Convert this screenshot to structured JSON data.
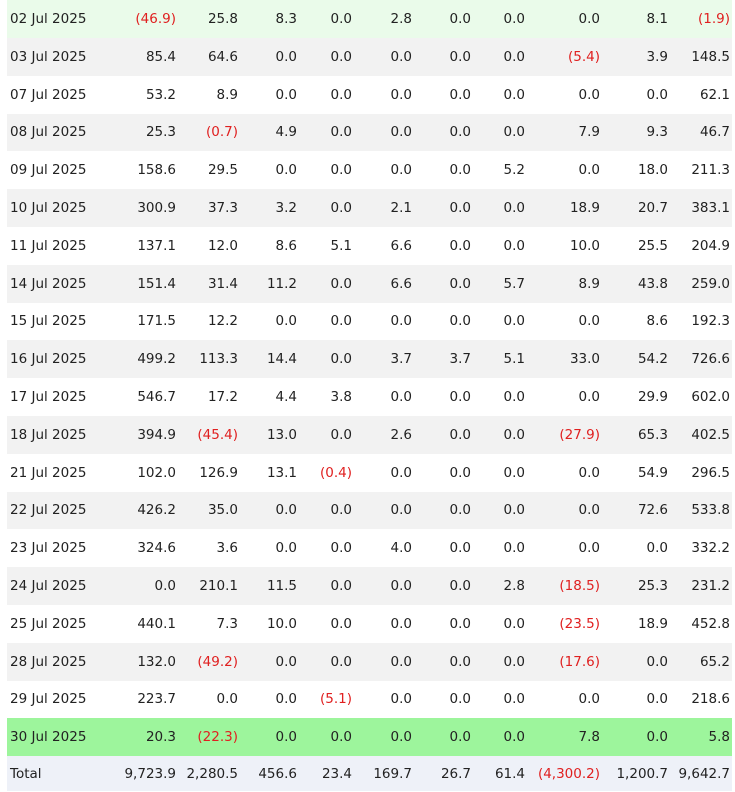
{
  "rows": [
    {
      "date": "02 Jul 2025",
      "style": "first",
      "values": [
        "(46.9)",
        "25.8",
        "8.3",
        "0.0",
        "2.8",
        "0.0",
        "0.0",
        "0.0",
        "8.1",
        "(1.9)"
      ]
    },
    {
      "date": "03 Jul 2025",
      "style": "striped",
      "values": [
        "85.4",
        "64.6",
        "0.0",
        "0.0",
        "0.0",
        "0.0",
        "0.0",
        "(5.4)",
        "3.9",
        "148.5"
      ]
    },
    {
      "date": "07 Jul 2025",
      "style": "plain",
      "values": [
        "53.2",
        "8.9",
        "0.0",
        "0.0",
        "0.0",
        "0.0",
        "0.0",
        "0.0",
        "0.0",
        "62.1"
      ]
    },
    {
      "date": "08 Jul 2025",
      "style": "striped",
      "values": [
        "25.3",
        "(0.7)",
        "4.9",
        "0.0",
        "0.0",
        "0.0",
        "0.0",
        "7.9",
        "9.3",
        "46.7"
      ]
    },
    {
      "date": "09 Jul 2025",
      "style": "plain",
      "values": [
        "158.6",
        "29.5",
        "0.0",
        "0.0",
        "0.0",
        "0.0",
        "5.2",
        "0.0",
        "18.0",
        "211.3"
      ]
    },
    {
      "date": "10 Jul 2025",
      "style": "striped",
      "values": [
        "300.9",
        "37.3",
        "3.2",
        "0.0",
        "2.1",
        "0.0",
        "0.0",
        "18.9",
        "20.7",
        "383.1"
      ]
    },
    {
      "date": "11 Jul 2025",
      "style": "plain",
      "values": [
        "137.1",
        "12.0",
        "8.6",
        "5.1",
        "6.6",
        "0.0",
        "0.0",
        "10.0",
        "25.5",
        "204.9"
      ]
    },
    {
      "date": "14 Jul 2025",
      "style": "striped",
      "values": [
        "151.4",
        "31.4",
        "11.2",
        "0.0",
        "6.6",
        "0.0",
        "5.7",
        "8.9",
        "43.8",
        "259.0"
      ]
    },
    {
      "date": "15 Jul 2025",
      "style": "plain",
      "values": [
        "171.5",
        "12.2",
        "0.0",
        "0.0",
        "0.0",
        "0.0",
        "0.0",
        "0.0",
        "8.6",
        "192.3"
      ]
    },
    {
      "date": "16 Jul 2025",
      "style": "striped",
      "values": [
        "499.2",
        "113.3",
        "14.4",
        "0.0",
        "3.7",
        "3.7",
        "5.1",
        "33.0",
        "54.2",
        "726.6"
      ]
    },
    {
      "date": "17 Jul 2025",
      "style": "plain",
      "values": [
        "546.7",
        "17.2",
        "4.4",
        "3.8",
        "0.0",
        "0.0",
        "0.0",
        "0.0",
        "29.9",
        "602.0"
      ]
    },
    {
      "date": "18 Jul 2025",
      "style": "striped",
      "values": [
        "394.9",
        "(45.4)",
        "13.0",
        "0.0",
        "2.6",
        "0.0",
        "0.0",
        "(27.9)",
        "65.3",
        "402.5"
      ]
    },
    {
      "date": "21 Jul 2025",
      "style": "plain",
      "values": [
        "102.0",
        "126.9",
        "13.1",
        "(0.4)",
        "0.0",
        "0.0",
        "0.0",
        "0.0",
        "54.9",
        "296.5"
      ]
    },
    {
      "date": "22 Jul 2025",
      "style": "striped",
      "values": [
        "426.2",
        "35.0",
        "0.0",
        "0.0",
        "0.0",
        "0.0",
        "0.0",
        "0.0",
        "72.6",
        "533.8"
      ]
    },
    {
      "date": "23 Jul 2025",
      "style": "plain",
      "values": [
        "324.6",
        "3.6",
        "0.0",
        "0.0",
        "4.0",
        "0.0",
        "0.0",
        "0.0",
        "0.0",
        "332.2"
      ]
    },
    {
      "date": "24 Jul 2025",
      "style": "striped",
      "values": [
        "0.0",
        "210.1",
        "11.5",
        "0.0",
        "0.0",
        "0.0",
        "2.8",
        "(18.5)",
        "25.3",
        "231.2"
      ]
    },
    {
      "date": "25 Jul 2025",
      "style": "plain",
      "values": [
        "440.1",
        "7.3",
        "10.0",
        "0.0",
        "0.0",
        "0.0",
        "0.0",
        "(23.5)",
        "18.9",
        "452.8"
      ]
    },
    {
      "date": "28 Jul 2025",
      "style": "striped",
      "values": [
        "132.0",
        "(49.2)",
        "0.0",
        "0.0",
        "0.0",
        "0.0",
        "0.0",
        "(17.6)",
        "0.0",
        "65.2"
      ]
    },
    {
      "date": "29 Jul 2025",
      "style": "plain",
      "values": [
        "223.7",
        "0.0",
        "0.0",
        "(5.1)",
        "0.0",
        "0.0",
        "0.0",
        "0.0",
        "0.0",
        "218.6"
      ]
    },
    {
      "date": "30 Jul 2025",
      "style": "highlight",
      "values": [
        "20.3",
        "(22.3)",
        "0.0",
        "0.0",
        "0.0",
        "0.0",
        "0.0",
        "7.8",
        "0.0",
        "5.8"
      ]
    }
  ],
  "total": {
    "label": "Total",
    "values": [
      "9,723.9",
      "2,280.5",
      "456.6",
      "23.4",
      "169.7",
      "26.7",
      "61.4",
      "(4,300.2)",
      "1,200.7",
      "9,642.7"
    ]
  },
  "colors": {
    "negative": "#e02020",
    "highlight_row": "#9df59c",
    "first_row": "#eafbea",
    "stripe": "#f2f2f2",
    "total_row": "#eef1f8"
  }
}
